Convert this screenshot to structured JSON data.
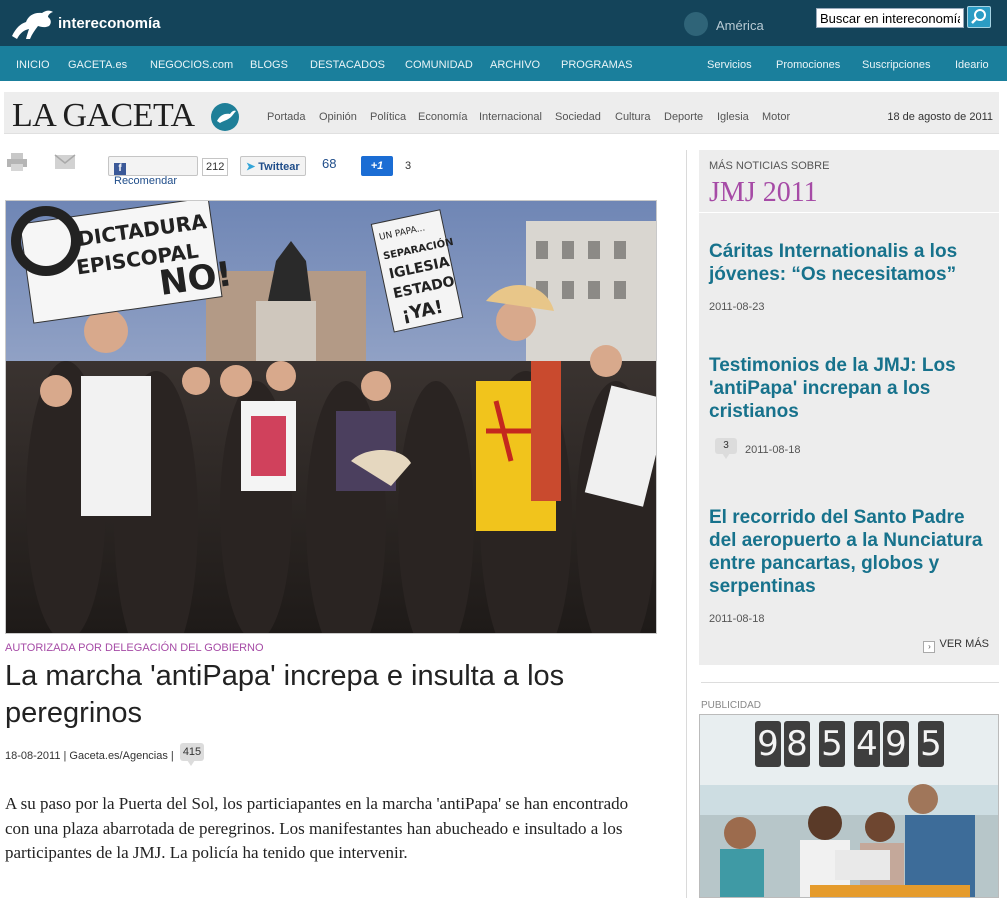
{
  "topbar": {
    "brand": "intereconomía",
    "region": "América",
    "search_value": "Buscar en intereconomía"
  },
  "nav": {
    "left": [
      "INICIO",
      "GACETA.es",
      "NEGOCIOS.com",
      "BLOGS",
      "DESTACADOS",
      "COMUNIDAD",
      "ARCHIVO",
      "PROGRAMAS"
    ],
    "right": [
      "Servicios",
      "Promociones",
      "Suscripciones",
      "Ideario"
    ]
  },
  "gaceta": {
    "logo": "LA GACETA",
    "sections": [
      "Portada",
      "Opinión",
      "Política",
      "Economía",
      "Internacional",
      "Sociedad",
      "Cultura",
      "Deporte",
      "Iglesia",
      "Motor"
    ],
    "date": "18 de agosto de 2011"
  },
  "share": {
    "facebook_label": "Recomendar",
    "facebook_count": "212",
    "twitter_label": "Twittear",
    "twitter_count": "68",
    "gplus_label": "+1",
    "gplus_count": "3"
  },
  "photo": {
    "sign1_line1": "DICTADURA",
    "sign1_line2": "EPISCOPAL",
    "sign1_line3": "NO!",
    "sign2_line1": "UN PAPA...",
    "sign2_line2": "SEPARACIÓN",
    "sign2_line3": "IGLESIA",
    "sign2_line4": "ESTADO",
    "sign2_line5": "¡YA!"
  },
  "article": {
    "kicker": "AUTORIZADA POR DELEGACIÓN DEL GOBIERNO",
    "headline": "La marcha 'antiPapa' increpa e insulta a los peregrinos",
    "byline": "18-08-2011 | Gaceta.es/Agencias |",
    "comments": "415",
    "lead": "A su paso por la Puerta del Sol, los particiapantes en la marcha 'antiPapa' se han encontrado con una plaza abarrotada de peregrinos. Los manifestantes han abucheado e insultado a los participantes de la JMJ. La policía ha tenido que intervenir."
  },
  "sidebar": {
    "label": "MÁS NOTICIAS SOBRE",
    "title": "JMJ 2011",
    "items": [
      {
        "title": "Cáritas Internationalis a los jóvenes: “Os necesitamos”",
        "date": "2011-08-23",
        "comments": ""
      },
      {
        "title": "Testimonios de la JMJ: Los 'antiPapa' increpan a los cristianos",
        "date": "2011-08-18",
        "comments": "3"
      },
      {
        "title": "El recorrido del Santo Padre del aeropuerto a la Nunciatura entre pancartas, globos y serpentinas",
        "date": "2011-08-18",
        "comments": ""
      }
    ],
    "ver_mas": "VER MÁS"
  },
  "ad": {
    "label": "PUBLICIDAD",
    "digits": [
      "9",
      "8",
      "5",
      "4",
      "9",
      "5"
    ]
  },
  "colors": {
    "topbar": "#14445a",
    "navbar": "#1a7f9c",
    "accent_purple": "#a64ba6",
    "link_teal": "#17728c"
  }
}
